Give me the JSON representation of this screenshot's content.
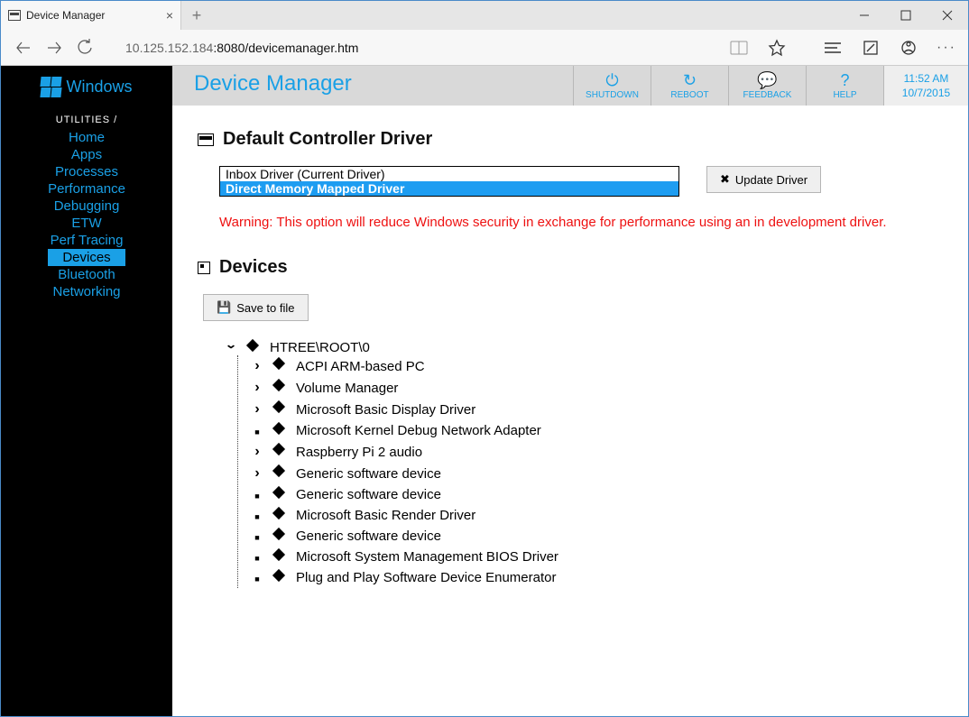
{
  "browser": {
    "tab_title": "Device Manager",
    "url_muted_prefix": "10.125.152.184",
    "url_dark": ":8080/devicemanager.htm"
  },
  "brand": "Windows",
  "sidebar": {
    "header": "UTILITIES /",
    "items": [
      "Home",
      "Apps",
      "Processes",
      "Performance",
      "Debugging",
      "ETW",
      "Perf Tracing",
      "Devices",
      "Bluetooth",
      "Networking"
    ],
    "active_index": 7
  },
  "header": {
    "title": "Device Manager",
    "buttons": [
      {
        "icon": "⏻",
        "label": "SHUTDOWN"
      },
      {
        "icon": "↻",
        "label": "REBOOT"
      },
      {
        "icon": "💬",
        "label": "FEEDBACK"
      },
      {
        "icon": "?",
        "label": "HELP"
      }
    ],
    "time": "11:52 AM",
    "date": "10/7/2015"
  },
  "driver_section_title": "Default Controller Driver",
  "driver_options": [
    "Inbox Driver (Current Driver)",
    "Direct Memory Mapped Driver"
  ],
  "selected_driver_index": 1,
  "update_btn": "Update Driver",
  "warning": "Warning: This option will reduce Windows security in exchange for performance using an in development driver.",
  "devices_section_title": "Devices",
  "save_btn": "Save to file",
  "tree": {
    "root": "HTREE\\ROOT\\0",
    "children": [
      {
        "expand": "r",
        "label": "ACPI ARM-based PC"
      },
      {
        "expand": "r",
        "label": "Volume Manager"
      },
      {
        "expand": "r",
        "label": "Microsoft Basic Display Driver"
      },
      {
        "expand": "n",
        "label": "Microsoft Kernel Debug Network Adapter"
      },
      {
        "expand": "r",
        "label": "Raspberry Pi 2 audio"
      },
      {
        "expand": "r",
        "label": "Generic software device"
      },
      {
        "expand": "n",
        "label": "Generic software device"
      },
      {
        "expand": "n",
        "label": "Microsoft Basic Render Driver"
      },
      {
        "expand": "n",
        "label": "Generic software device"
      },
      {
        "expand": "n",
        "label": "Microsoft System Management BIOS Driver"
      },
      {
        "expand": "n",
        "label": "Plug and Play Software Device Enumerator"
      }
    ]
  }
}
